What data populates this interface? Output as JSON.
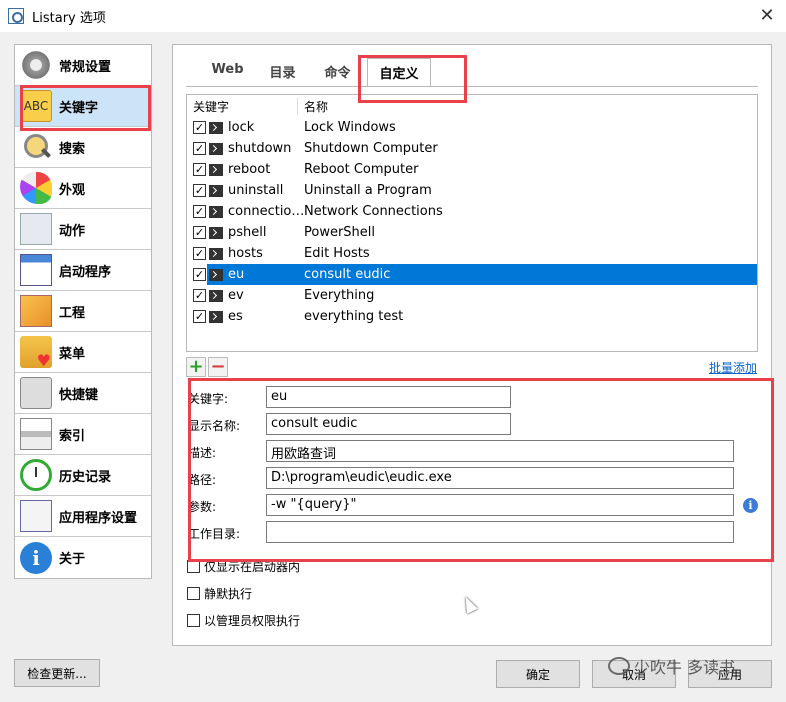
{
  "window": {
    "title": "Listary 选项",
    "close_label": "✕"
  },
  "sidebar": {
    "items": [
      {
        "label": "常规设置",
        "icon": "gear-icon"
      },
      {
        "label": "关键字",
        "icon": "abc-icon",
        "icon_text": "ABC"
      },
      {
        "label": "搜索",
        "icon": "search-icon"
      },
      {
        "label": "外观",
        "icon": "palette-icon"
      },
      {
        "label": "动作",
        "icon": "list-icon"
      },
      {
        "label": "启动程序",
        "icon": "window-icon"
      },
      {
        "label": "工程",
        "icon": "cube-icon"
      },
      {
        "label": "菜单",
        "icon": "folder-heart-icon"
      },
      {
        "label": "快捷键",
        "icon": "keyboard-icon"
      },
      {
        "label": "索引",
        "icon": "index-icon"
      },
      {
        "label": "历史记录",
        "icon": "clock-icon"
      },
      {
        "label": "应用程序设置",
        "icon": "apps-icon"
      },
      {
        "label": "关于",
        "icon": "info-icon",
        "icon_text": "i"
      }
    ],
    "active_index": 1
  },
  "tabs": [
    {
      "label": "Web"
    },
    {
      "label": "目录"
    },
    {
      "label": "命令"
    },
    {
      "label": "自定义"
    }
  ],
  "active_tab": 3,
  "keyword_list": {
    "columns": {
      "key": "关键字",
      "name": "名称"
    },
    "rows": [
      {
        "key": "lock",
        "name": "Lock Windows",
        "checked": true
      },
      {
        "key": "shutdown",
        "name": "Shutdown Computer",
        "checked": true
      },
      {
        "key": "reboot",
        "name": "Reboot Computer",
        "checked": true
      },
      {
        "key": "uninstall",
        "name": "Uninstall a Program",
        "checked": true
      },
      {
        "key": "connectio…",
        "name": "Network Connections",
        "checked": true
      },
      {
        "key": "pshell",
        "name": "PowerShell",
        "checked": true
      },
      {
        "key": "hosts",
        "name": "Edit Hosts",
        "checked": true
      },
      {
        "key": "eu",
        "name": "consult eudic",
        "checked": true,
        "selected": true
      },
      {
        "key": "ev",
        "name": "Everything",
        "checked": true
      },
      {
        "key": "es",
        "name": "everything test",
        "checked": true
      }
    ],
    "add_label": "+",
    "remove_label": "−",
    "batch_add_label": "批量添加"
  },
  "form": {
    "keyword_label": "关键字:",
    "keyword_value": "eu",
    "display_name_label": "显示名称:",
    "display_name_value": "consult eudic",
    "description_label": "描述:",
    "description_value": "用欧路查词",
    "path_label": "路径:",
    "path_value": "D:\\program\\eudic\\eudic.exe",
    "params_label": "参数:",
    "params_value": "-w \"{query}\"",
    "workdir_label": "工作目录:",
    "workdir_value": "",
    "info_icon_text": "i"
  },
  "options": {
    "launcher_only": "仅显示在启动器内",
    "silent": "静默执行",
    "run_as_admin": "以管理员权限执行"
  },
  "buttons": {
    "check_update": "检查更新...",
    "ok": "确定",
    "cancel": "取消",
    "apply": "应用"
  },
  "watermark": {
    "text": "少吹牛 多读书"
  },
  "colors": {
    "highlight_box": "#e8414a",
    "selection": "#0078d7",
    "active_nav": "#cce4f7"
  }
}
